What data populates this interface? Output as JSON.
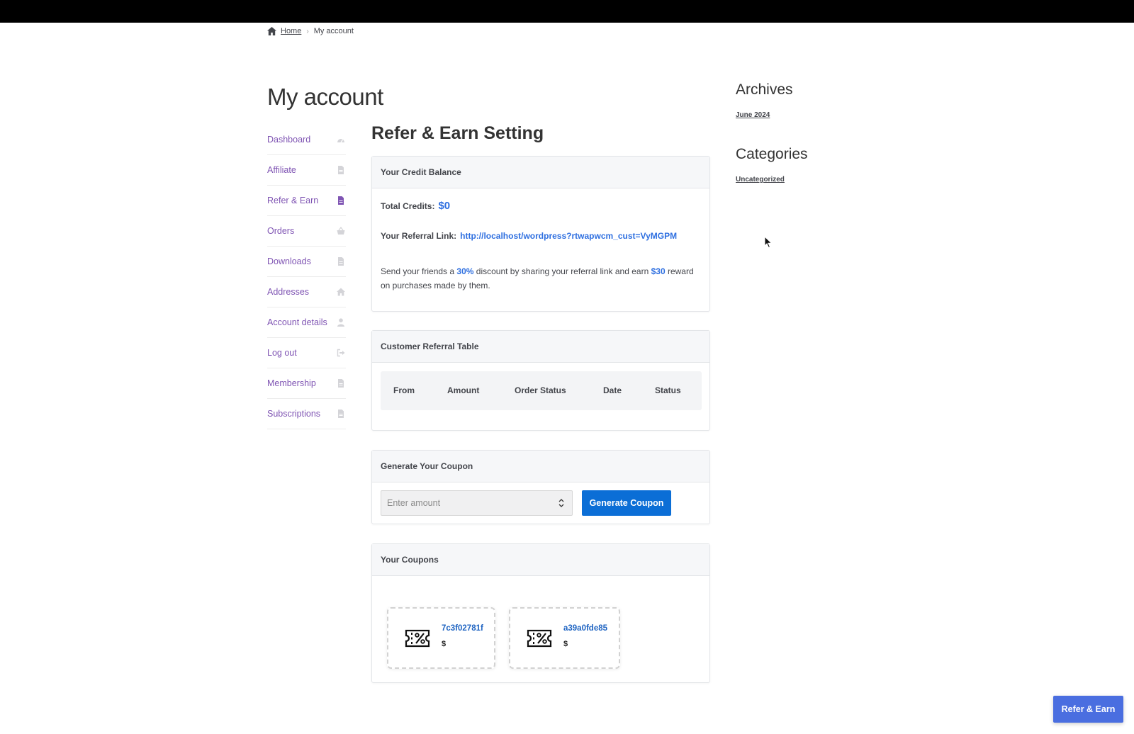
{
  "breadcrumb": {
    "home": "Home",
    "separator": "›",
    "current": "My account"
  },
  "page_title": "My account",
  "nav": [
    {
      "label": "Dashboard",
      "icon": "dashboard-icon"
    },
    {
      "label": "Affiliate",
      "icon": "file-icon"
    },
    {
      "label": "Refer & Earn",
      "icon": "file-icon"
    },
    {
      "label": "Orders",
      "icon": "basket-icon"
    },
    {
      "label": "Downloads",
      "icon": "file-icon"
    },
    {
      "label": "Addresses",
      "icon": "home-icon"
    },
    {
      "label": "Account details",
      "icon": "user-icon"
    },
    {
      "label": "Log out",
      "icon": "logout-icon"
    },
    {
      "label": "Membership",
      "icon": "file-icon"
    },
    {
      "label": "Subscriptions",
      "icon": "file-icon"
    }
  ],
  "main": {
    "title": "Refer & Earn Setting",
    "credit": {
      "header": "Your Credit Balance",
      "total_label": "Total Credits:",
      "total_value": "$0",
      "link_label": "Your Referral Link:",
      "link_value": "http://localhost/wordpress?rtwapwcm_cust=VyMGPM",
      "promo_pre": "Send your friends a",
      "promo_discount": "30%",
      "promo_mid": "discount by sharing your referral link and earn",
      "promo_reward": "$30",
      "promo_post": "reward on purchases made by them."
    },
    "referral_table": {
      "header": "Customer Referral Table",
      "columns": [
        "From",
        "Amount",
        "Order Status",
        "Date",
        "Status"
      ]
    },
    "generate": {
      "header": "Generate Your Coupon",
      "placeholder": "Enter amount",
      "button": "Generate Coupon"
    },
    "coupons": {
      "header": "Your Coupons",
      "items": [
        {
          "code": "7c3f02781f",
          "amount": "$"
        },
        {
          "code": "a39a0fde85",
          "amount": "$"
        }
      ]
    }
  },
  "sidebar": {
    "archives_title": "Archives",
    "archives_link": "June 2024",
    "categories_title": "Categories",
    "categories_link": "Uncategorized"
  },
  "floating_button": "Refer & Earn",
  "colors": {
    "accent": "#2e6fe0",
    "nav_link": "#7f54b3",
    "button": "#0b6ed6",
    "floating_button": "#4a6ee0"
  }
}
